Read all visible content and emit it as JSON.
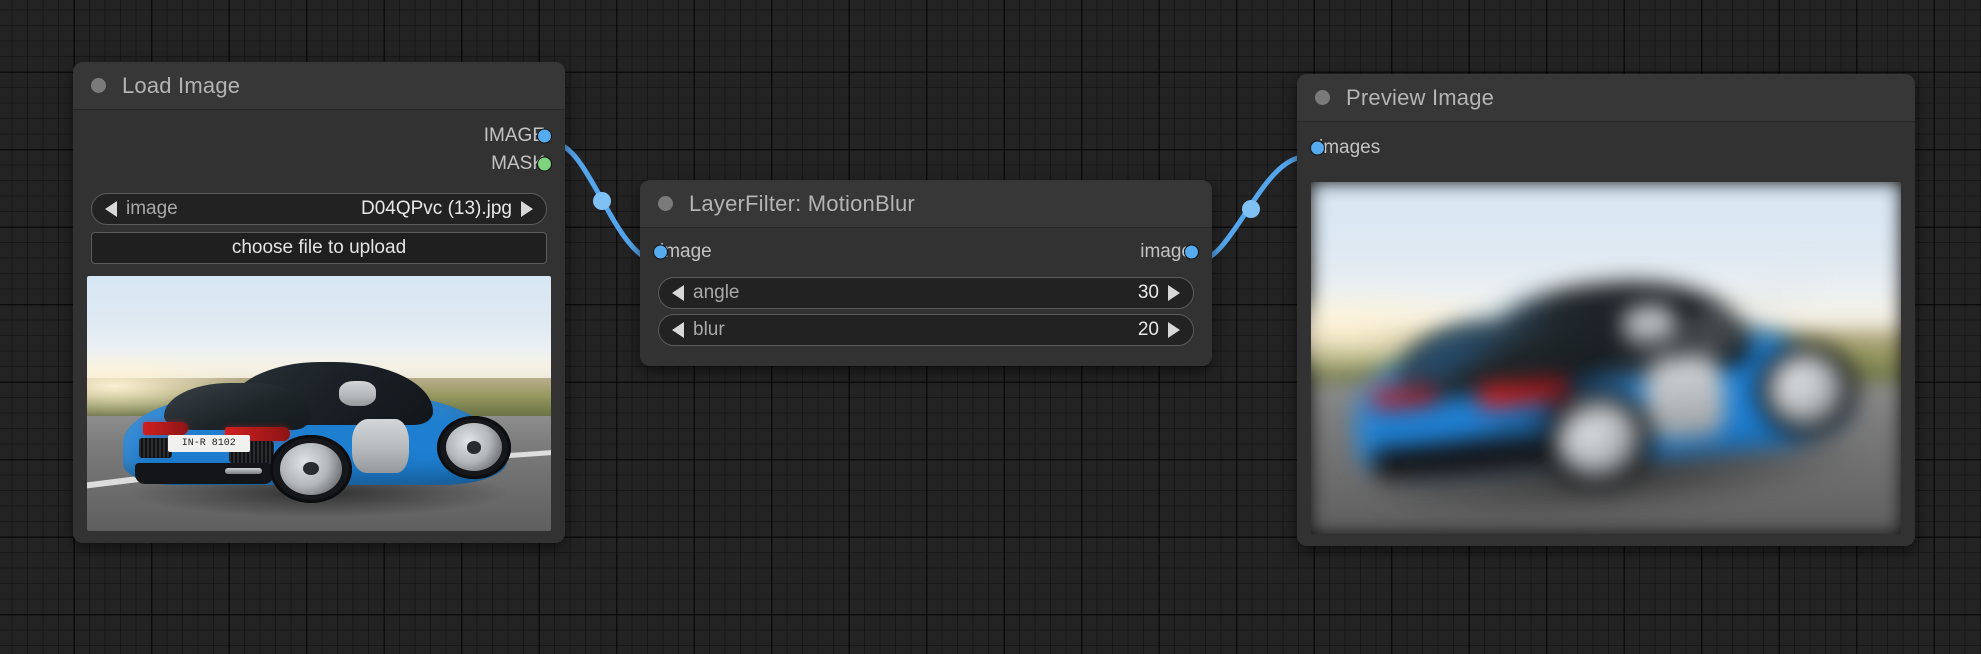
{
  "canvas": {
    "background_color": "#232323",
    "grid_color": "#1a1a1a"
  },
  "nodes": [
    {
      "id": "load-image",
      "title": "Load Image",
      "outputs": [
        {
          "label": "IMAGE",
          "color": "#55aaf0"
        },
        {
          "label": "MASK",
          "color": "#7fd37f"
        }
      ],
      "widgets": [
        {
          "type": "combo",
          "name": "image",
          "value": "D04QPvc (13).jpg"
        },
        {
          "type": "button",
          "label": "choose file to upload"
        }
      ],
      "preview": {
        "alt": "Blue Audi R8 sports car driving on a road, rear three-quarter view",
        "plate": "IN-R 8102"
      }
    },
    {
      "id": "layerfilter-motionblur",
      "title": "LayerFilter: MotionBlur",
      "inputs": [
        {
          "label": "image",
          "color": "#55aaf0"
        }
      ],
      "outputs": [
        {
          "label": "image",
          "color": "#55aaf0"
        }
      ],
      "widgets": [
        {
          "type": "number",
          "name": "angle",
          "value": "30"
        },
        {
          "type": "number",
          "name": "blur",
          "value": "20"
        }
      ]
    },
    {
      "id": "preview-image",
      "title": "Preview Image",
      "inputs": [
        {
          "label": "images",
          "color": "#55aaf0"
        }
      ],
      "preview": {
        "alt": "Motion blurred blue Audi R8 sports car",
        "plate": ""
      }
    }
  ],
  "links": [
    {
      "from": "load-image.IMAGE",
      "to": "layerfilter-motionblur.image",
      "color": "#54a5ec"
    },
    {
      "from": "layerfilter-motionblur.image",
      "to": "preview-image.images",
      "color": "#54a5ec"
    }
  ]
}
